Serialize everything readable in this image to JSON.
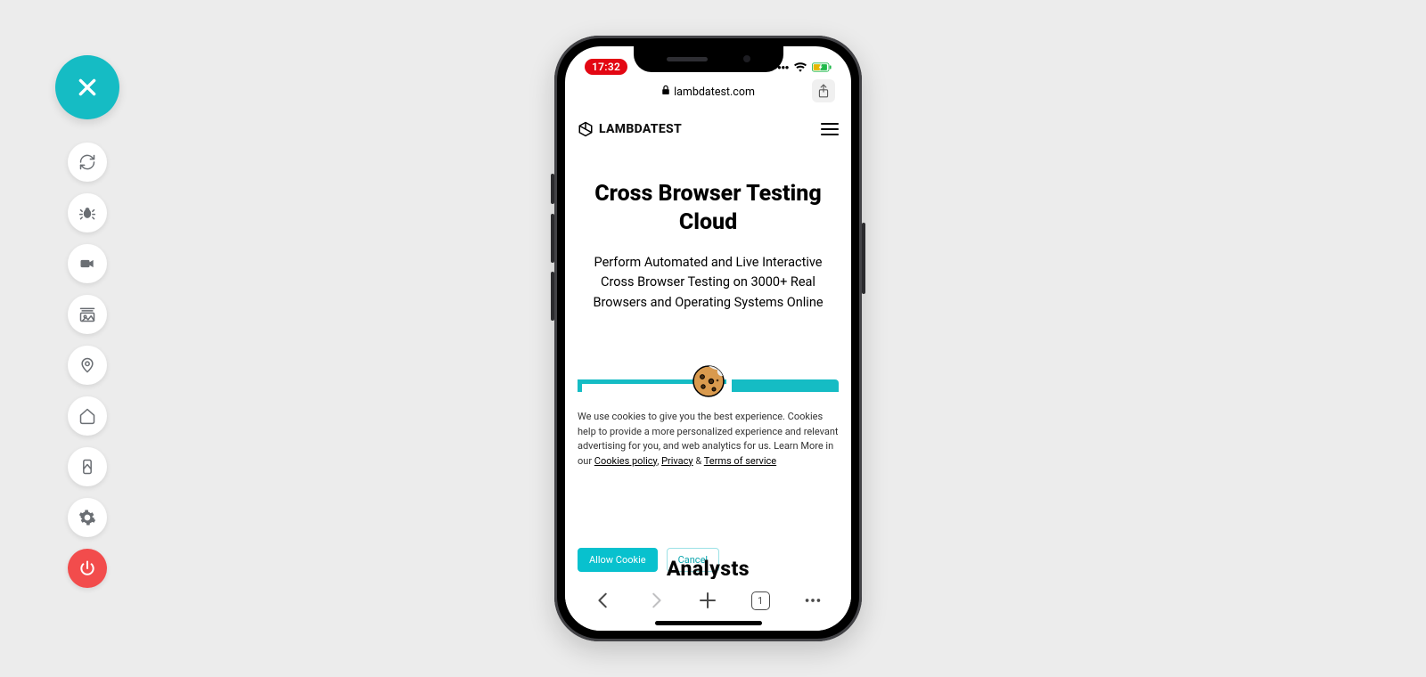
{
  "toolbar": {
    "close": "close",
    "items": [
      {
        "name": "refresh"
      },
      {
        "name": "bug"
      },
      {
        "name": "record"
      },
      {
        "name": "screenshot"
      },
      {
        "name": "location"
      },
      {
        "name": "home"
      },
      {
        "name": "device"
      },
      {
        "name": "settings"
      },
      {
        "name": "power"
      }
    ]
  },
  "device": {
    "time": "17:32",
    "url_host": "lambdatest.com",
    "tabs_count": "1"
  },
  "site": {
    "brand_name": "LAMBDATEST",
    "hero_title": "Cross Browser Testing Cloud",
    "hero_subtitle": "Perform Automated and Live Interactive Cross Browser Testing on 3000+ Real Browsers and Operating Systems Online",
    "peek_text": "Analysts"
  },
  "cookies": {
    "body_pre": "We use cookies to give you the best experience. Cookies help to provide a more personalized experience and relevant advertising for you, and web analytics for us. Learn More in our ",
    "link1": "Cookies policy",
    "sep1": ", ",
    "link2": "Privacy",
    "sep2": " & ",
    "link3": "Terms of service",
    "allow": "Allow Cookie",
    "cancel": "Cancel"
  }
}
